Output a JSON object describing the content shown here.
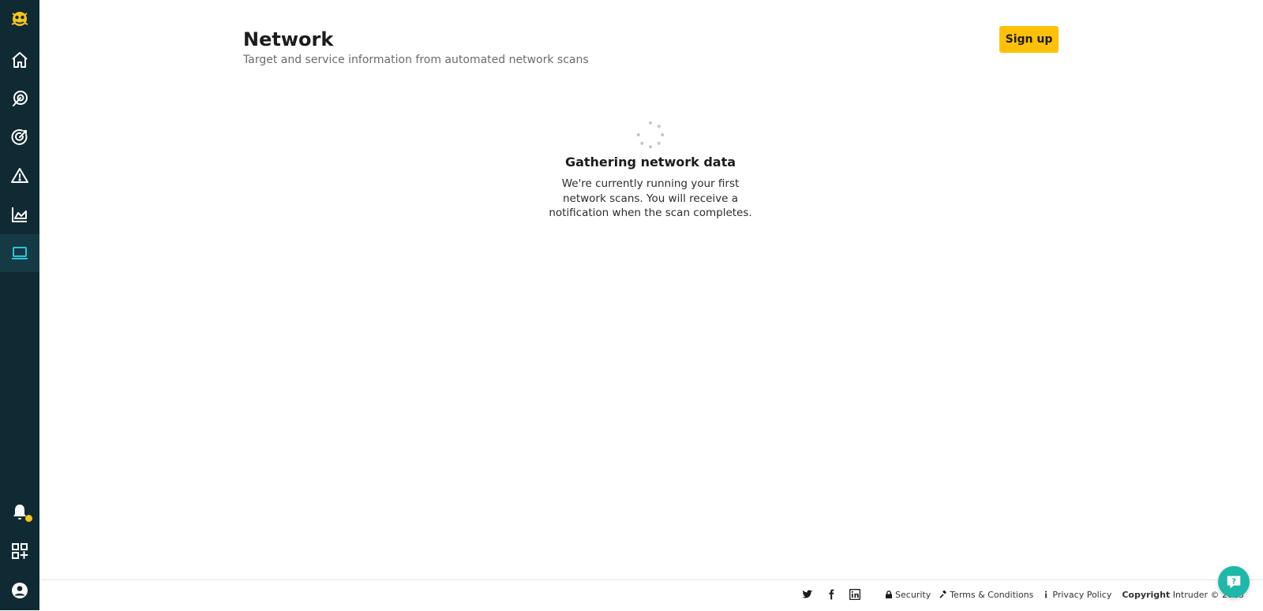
{
  "header": {
    "title": "Network",
    "subtitle": "Target and service information from automated network scans",
    "signup_label": "Sign up"
  },
  "loading": {
    "title": "Gathering network data",
    "message": "We're currently running your first network scans. You will receive a notification when the scan completes."
  },
  "sidebar": {
    "items": [
      {
        "icon": "home-icon"
      },
      {
        "icon": "scan-icon"
      },
      {
        "icon": "target-icon"
      },
      {
        "icon": "warning-icon"
      },
      {
        "icon": "chart-icon"
      },
      {
        "icon": "laptop-icon",
        "active": true
      }
    ],
    "bottom": [
      {
        "icon": "bell-icon"
      },
      {
        "icon": "integrations-icon"
      },
      {
        "icon": "user-icon"
      }
    ]
  },
  "footer": {
    "security": "Security",
    "terms": "Terms & Conditions",
    "privacy": "Privacy Policy",
    "copyright_label": "Copyright",
    "copyright_text": "Intruder © 2023"
  },
  "colors": {
    "sidebar_bg": "#0f2a33",
    "accent_yellow": "#ffc107",
    "active_teal": "#2ec4d6",
    "help_teal": "#1fb7a8"
  }
}
